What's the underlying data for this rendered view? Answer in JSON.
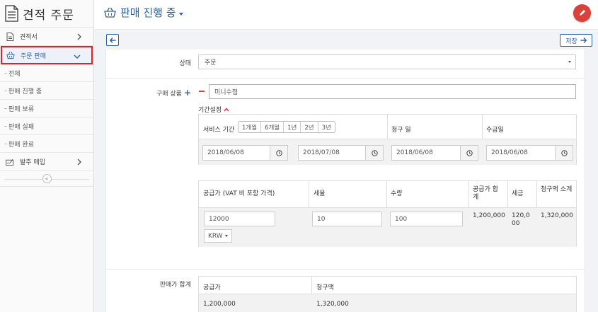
{
  "sidebar": {
    "title": "견적 주문",
    "items": [
      {
        "label": "견적서",
        "icon": "document-icon"
      },
      {
        "label": "주문 판매",
        "icon": "basket-icon"
      },
      {
        "label": "발주 매입",
        "icon": "signature-icon"
      }
    ],
    "sub_items": [
      "전체",
      "판매 진행 중",
      "판매 보류",
      "판매 실패",
      "판매 완료"
    ],
    "collapse_glyph": "«"
  },
  "header": {
    "title": "판매 진행 중"
  },
  "toolbar": {
    "save_label": "저장"
  },
  "form": {
    "status_label": "상태",
    "status_value": "주문",
    "product_label": "구매 상품",
    "product_plus": "+",
    "product_value": "미니수첩",
    "period_title": "기간설정",
    "service_period_label": "서비스 기간",
    "period_options": [
      "1개월",
      "6개월",
      "1년",
      "2년",
      "3년"
    ],
    "billing_day_label": "청구 일",
    "receipt_day_label": "수금일",
    "dates": [
      "2018/06/08",
      "2018/07/08",
      "2018/06/08",
      "2018/06/08"
    ],
    "price_headers": {
      "supply_price": "공급가 (VAT 비 포함 가격)",
      "tax_rate": "세율",
      "quantity": "수량",
      "supply_total": "공급가 합계",
      "tax": "세금",
      "billed_subtotal": "청구액 소계"
    },
    "price_values": {
      "supply_price": "12000",
      "currency": "KRW",
      "tax_rate": "10",
      "quantity": "100",
      "supply_total": "1,200,000",
      "tax": "120,000",
      "billed_subtotal": "1,320,000"
    },
    "sale_total_label": "판매가 합계",
    "total_headers": {
      "supply_price": "공급가",
      "billed": "청구액"
    },
    "total_values": {
      "supply_price": "1,200,000",
      "billed": "1,320,000"
    }
  },
  "colors": {
    "accent": "#2b5fa6",
    "danger": "#d9423a",
    "highlight_border": "#e0202d",
    "focus_border": "#f0a830"
  }
}
